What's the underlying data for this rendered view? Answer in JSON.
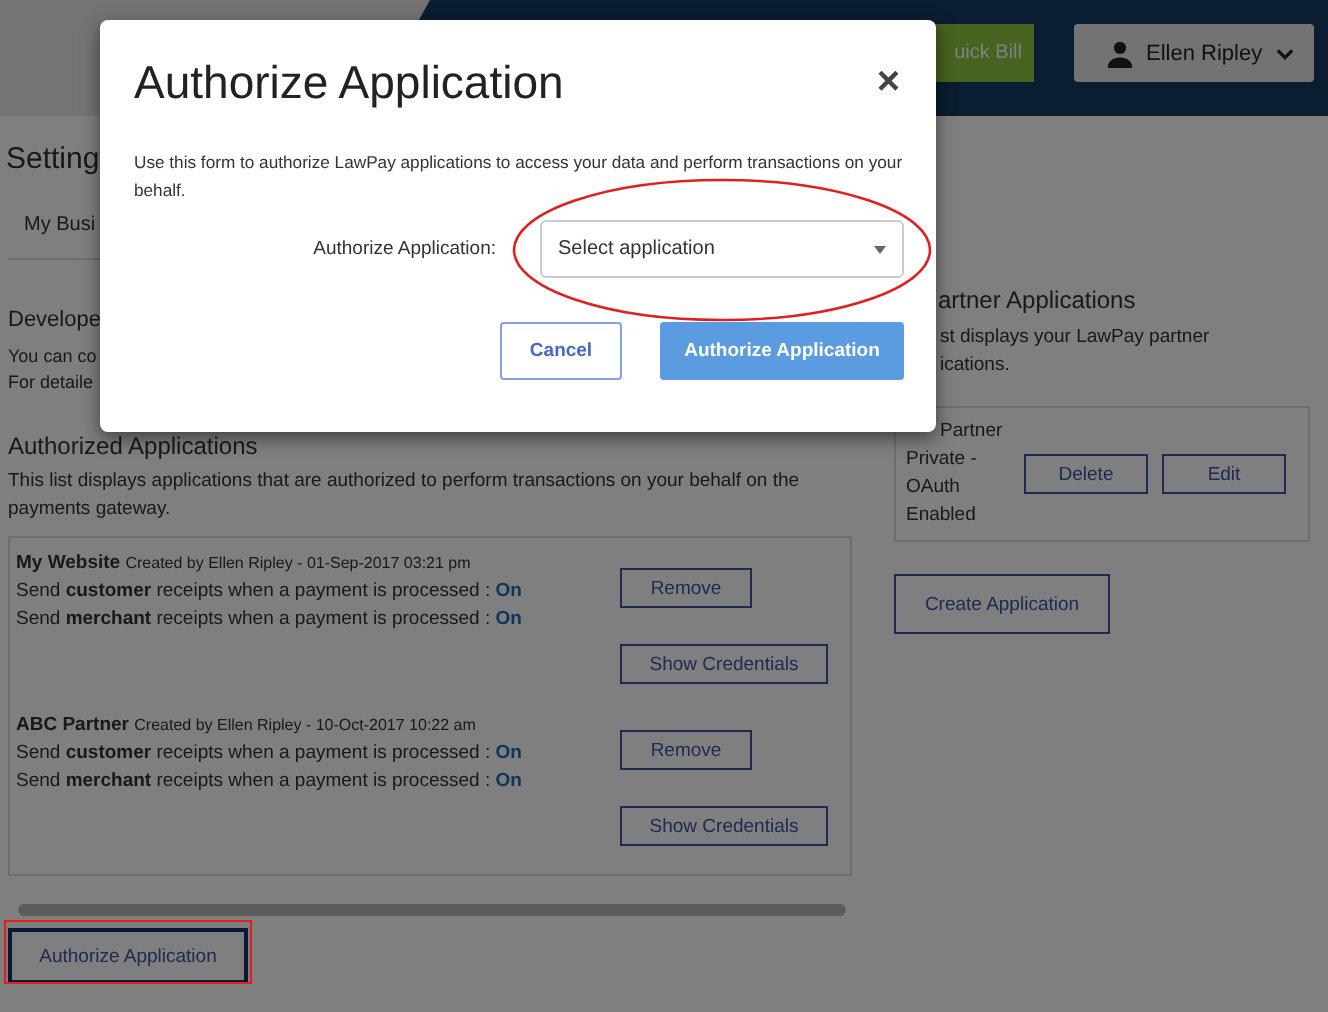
{
  "header": {
    "quick_bill_label": "uick Bill",
    "user_name": "Ellen Ripley"
  },
  "page": {
    "title": "Setting",
    "tab": "My Busi",
    "developer": {
      "heading": "Develope",
      "lines": [
        "You can co",
        "For detaile"
      ]
    },
    "authorized": {
      "heading": "Authorized Applications",
      "description": "This list displays applications that are authorized to perform transactions on your behalf on the payments gateway.",
      "apps": [
        {
          "name": "My Website",
          "created": "Created by Ellen Ripley - 01-Sep-2017 03:21 pm",
          "settings": [
            {
              "text": "Send **customer** receipts when a payment is processed :",
              "value": "On"
            },
            {
              "text": "Send **merchant** receipts when a payment is processed :",
              "value": "On"
            }
          ],
          "buttons": [
            "Remove",
            "Show Credentials"
          ]
        },
        {
          "name": "ABC Partner",
          "created": "Created by Ellen Ripley - 10-Oct-2017 10:22 am",
          "settings": [
            {
              "text": "Send **customer** receipts when a payment is processed :",
              "value": "On"
            },
            {
              "text": "Send **merchant** receipts when a payment is processed :",
              "value": "On"
            }
          ],
          "buttons": [
            "Remove",
            "Show Credentials"
          ]
        }
      ],
      "authorize_button": "Authorize Application"
    },
    "partner": {
      "heading": "artner Applications",
      "description_lines": [
        "st displays your LawPay partner",
        "ications."
      ],
      "card": {
        "first_line": "Partner",
        "lines": [
          "Private -",
          "OAuth",
          "Enabled"
        ],
        "buttons": [
          "Delete",
          "Edit"
        ]
      },
      "create_button": "Create Application"
    }
  },
  "modal": {
    "title": "Authorize Application",
    "close": "×",
    "description": "Use this form to authorize LawPay applications to access your data and perform transactions on your behalf.",
    "field_label": "Authorize Application:",
    "select": {
      "value": "Select application"
    },
    "buttons": [
      {
        "label": "Cancel",
        "kind": "secondary"
      },
      {
        "label": "Authorize Application",
        "kind": "primary"
      }
    ]
  }
}
